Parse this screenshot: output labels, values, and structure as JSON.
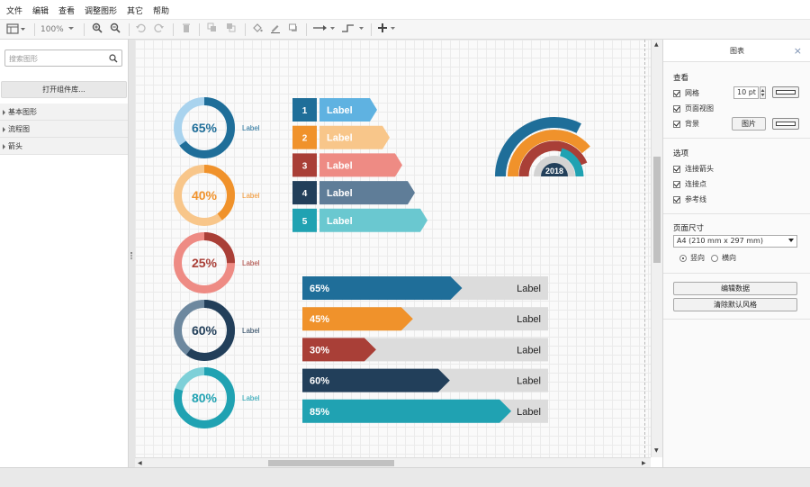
{
  "menu": [
    "文件",
    "编辑",
    "查看",
    "调整图形",
    "其它",
    "帮助"
  ],
  "toolbar": {
    "zoom": "100%"
  },
  "sidebar": {
    "search_placeholder": "搜索图形",
    "open_library": "打开组件库...",
    "sections": [
      "基本图形",
      "流程图",
      "箭头"
    ]
  },
  "diagram": {
    "donuts": [
      {
        "pct": "65%",
        "value": 0.65,
        "label": "Label",
        "color": "#1f6e99",
        "light": "#a9d3ee"
      },
      {
        "pct": "40%",
        "value": 0.4,
        "label": "Label",
        "color": "#f0922b",
        "light": "#f8c68a"
      },
      {
        "pct": "25%",
        "value": 0.25,
        "label": "Label",
        "color": "#a93f37",
        "light": "#ee8b84"
      },
      {
        "pct": "60%",
        "value": 0.6,
        "label": "Label",
        "color": "#223f5a",
        "light": "#6d889f"
      },
      {
        "pct": "80%",
        "value": 0.8,
        "label": "Label",
        "color": "#20a2b2",
        "light": "#7ed0d8"
      }
    ],
    "steps": [
      {
        "num": "1",
        "label": "Label",
        "dark": "#1f6e99",
        "light": "#5fb2e1"
      },
      {
        "num": "2",
        "label": "Label",
        "dark": "#f0922b",
        "light": "#f8c68a"
      },
      {
        "num": "3",
        "label": "Label",
        "dark": "#a93f37",
        "light": "#ee8b84"
      },
      {
        "num": "4",
        "label": "Label",
        "dark": "#223f5a",
        "light": "#5f7d98"
      },
      {
        "num": "5",
        "label": "Label",
        "dark": "#20a2b2",
        "light": "#6ac8d0"
      }
    ],
    "arc_center_label": "2018",
    "arc_colors": [
      "#1f6e99",
      "#f0922b",
      "#a93f37",
      "#20a2b2",
      "#d3d3d3"
    ],
    "bars": [
      {
        "pct": "65%",
        "value": 0.65,
        "label": "Label",
        "color": "#1f6e99"
      },
      {
        "pct": "45%",
        "value": 0.45,
        "label": "Label",
        "color": "#f0922b"
      },
      {
        "pct": "30%",
        "value": 0.3,
        "label": "Label",
        "color": "#a93f37"
      },
      {
        "pct": "60%",
        "value": 0.6,
        "label": "Label",
        "color": "#223f5a"
      },
      {
        "pct": "85%",
        "value": 0.85,
        "label": "Label",
        "color": "#20a2b2"
      }
    ]
  },
  "panel": {
    "title": "图表",
    "view_heading": "查看",
    "grid_label": "网格",
    "grid_size": "10 pt",
    "page_view_label": "页面视图",
    "background_label": "背景",
    "image_button": "图片",
    "options_heading": "选项",
    "connection_arrows": "连接箭头",
    "connection_points": "连接点",
    "guides": "参考线",
    "page_size_heading": "页面尺寸",
    "page_size_value": "A4 (210 mm x 297 mm)",
    "portrait": "竖向",
    "landscape": "横向",
    "edit_data": "编辑数据",
    "clear_style": "清除默认风格"
  }
}
